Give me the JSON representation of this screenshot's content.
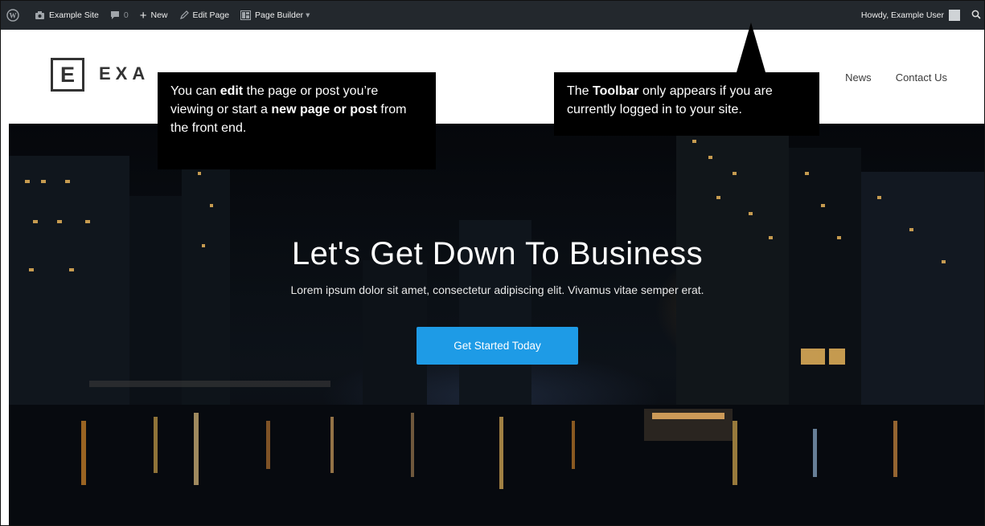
{
  "admin_bar": {
    "site_name": "Example Site",
    "comments_count": "0",
    "new_label": "New",
    "edit_page_label": "Edit Page",
    "page_builder_label": "Page Builder",
    "page_builder_caret": "▾",
    "greeting": "Howdy, Example User"
  },
  "header": {
    "logo_letter": "E",
    "logo_text": "EXA",
    "nav_items": [
      "News",
      "Contact Us"
    ]
  },
  "hero": {
    "title": "Let's Get Down To Business",
    "subtitle": "Lorem ipsum dolor sit amet, consectetur adipiscing elit. Vivamus vitae semper erat.",
    "cta_label": "Get Started Today"
  },
  "callouts": {
    "left": {
      "t1": "You can ",
      "b1": "edit",
      "t2": " the page or post you’re viewing or start a ",
      "b2": "new page or post",
      "t3": " from the front end."
    },
    "right": {
      "t1": "The ",
      "b1": "Toolbar",
      "t2": " only appears if you are currently logged in to your site."
    }
  },
  "colors": {
    "admin_bar": "#23282d",
    "cta": "#1e9be6",
    "callout": "#000000"
  },
  "icons": [
    "wordpress-icon",
    "site-home-icon",
    "comments-icon",
    "plus-icon",
    "pencil-icon",
    "page-builder-icon",
    "search-icon"
  ]
}
